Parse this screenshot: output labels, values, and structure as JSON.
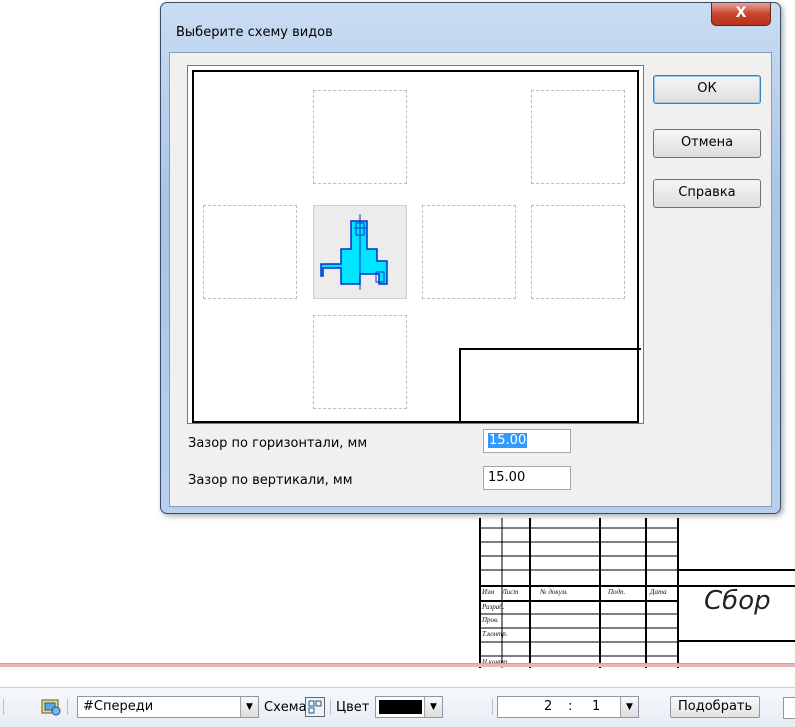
{
  "dialog": {
    "title": "Выберите схему видов",
    "close_label": "X",
    "buttons": {
      "ok": "ОК",
      "cancel": "Отмена",
      "help": "Справка"
    },
    "horizontal_gap": {
      "label": "Зазор по горизонтали, мм",
      "value": "15.00"
    },
    "vertical_gap": {
      "label": "Зазор по вертикали, мм",
      "value": "15.00"
    }
  },
  "title_block": {
    "headers": [
      "Изм",
      "Лист",
      "№ докум.",
      "Подп.",
      "Дата"
    ],
    "rows": [
      "Разраб.",
      "Пров.",
      "Т.контр.",
      "Н.контр."
    ],
    "designation_text": "Сбор"
  },
  "toolbar": {
    "view_name": "#Спереди",
    "scheme_label": "Схема",
    "color_label": "Цвет",
    "color_value": "#000000",
    "scale_left": "2",
    "scale_sep": ":",
    "scale_right": "1",
    "fit_label": "Подобрать"
  },
  "colors": {
    "accent": "#3399ff",
    "model_fill": "#00e5ff",
    "model_stroke": "#0033cc"
  }
}
